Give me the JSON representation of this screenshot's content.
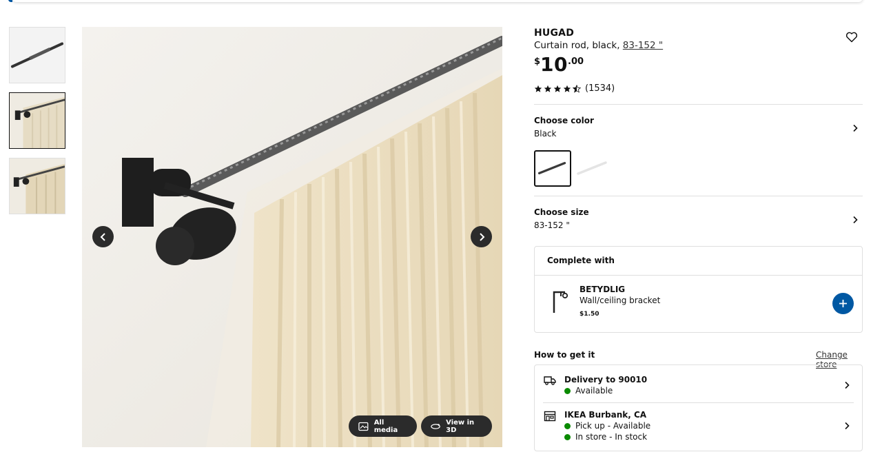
{
  "thumbnails": [
    {
      "label": "Curtain rod product image",
      "active": false
    },
    {
      "label": "Curtain rod with curtain, close-up",
      "active": true
    },
    {
      "label": "Curtain rod with curtain",
      "active": false
    }
  ],
  "media": {
    "all_media_label": "All media",
    "view3d_label": "View in 3D"
  },
  "product": {
    "name": "HUGAD",
    "description": "Curtain rod, black,",
    "size_link": "83-152 \"",
    "price": {
      "currency": "$",
      "integer": "10",
      "decimal": ".00"
    },
    "rating": {
      "stars": 4.5,
      "count": "(1534)"
    }
  },
  "color": {
    "label": "Choose color",
    "value": "Black",
    "swatches": [
      {
        "name": "Black",
        "selected": true,
        "color": "#3a3a3a"
      },
      {
        "name": "White",
        "selected": false,
        "color": "#f2f2f2"
      }
    ]
  },
  "size": {
    "label": "Choose size",
    "value": "83-152 \""
  },
  "complete_with": {
    "heading": "Complete with",
    "item": {
      "name": "BETYDLIG",
      "description": "Wall/ceiling bracket",
      "price": "$1.50"
    }
  },
  "fulfillment": {
    "heading": "How to get it",
    "change_store_label": "Change store",
    "delivery": {
      "title": "Delivery to 90010",
      "status": "Available"
    },
    "store": {
      "title": "IKEA Burbank, CA",
      "pickup_status": "Pick up - Available",
      "instore_status": "In store - In stock"
    }
  },
  "colors": {
    "accent": "#0058a3",
    "available": "#0a8a00",
    "dark_button": "#2b2b2b"
  }
}
